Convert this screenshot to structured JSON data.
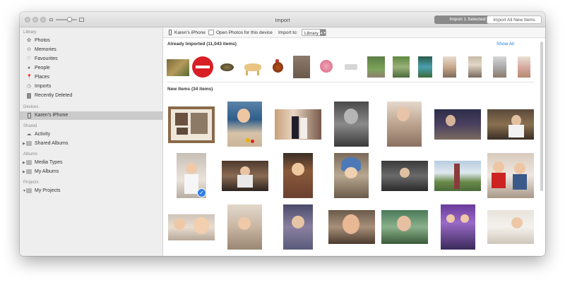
{
  "window": {
    "title": "Import"
  },
  "titlebar": {
    "import_selected_label": "Import 1 Selected",
    "import_all_label": "Import All New Items"
  },
  "sidebar": {
    "library_header": "Library",
    "library_items": [
      {
        "label": "Photos",
        "icon": "photos-icon"
      },
      {
        "label": "Memories",
        "icon": "memories-icon"
      },
      {
        "label": "Favourites",
        "icon": "heart-icon"
      },
      {
        "label": "People",
        "icon": "person-icon"
      },
      {
        "label": "Places",
        "icon": "pin-icon"
      },
      {
        "label": "Imports",
        "icon": "clock-icon"
      },
      {
        "label": "Recently Deleted",
        "icon": "trash-icon"
      }
    ],
    "devices_header": "Devices",
    "device_item": {
      "label": "Karen's iPhone",
      "icon": "iphone-icon"
    },
    "shared_header": "Shared",
    "shared_items": [
      {
        "label": "Activity",
        "icon": "cloud-icon"
      },
      {
        "label": "Shared Albums",
        "icon": "folder-icon"
      }
    ],
    "albums_header": "Albums",
    "album_items": [
      {
        "label": "Media Types",
        "icon": "folder-icon"
      },
      {
        "label": "My Albums",
        "icon": "folder-icon"
      }
    ],
    "projects_header": "Projects",
    "project_items": [
      {
        "label": "My Projects",
        "icon": "folder-icon"
      }
    ]
  },
  "toolbar": {
    "device_name": "Karen's iPhone",
    "open_photos_label": "Open Photos for this device",
    "open_photos_checked": false,
    "import_to_label": "Import to:",
    "import_to_value": "Library"
  },
  "already_imported": {
    "title": "Already Imported (11,043 items)",
    "show_all_label": "Show All"
  },
  "new_items": {
    "title": "New Items (34 items)",
    "selected_count": 1
  },
  "colors": {
    "accent": "#1a7bd6",
    "selection_badge": "#2e7ee6",
    "primary_button": "#8a8a8a",
    "sidebar_bg": "#eeeeef",
    "sidebar_selected": "#cbcbcb"
  }
}
